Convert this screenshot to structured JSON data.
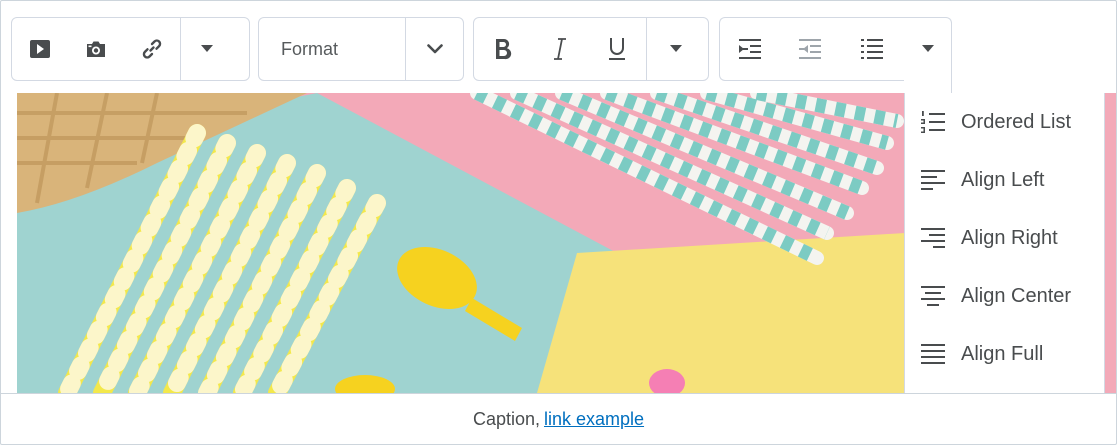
{
  "toolbar": {
    "format_label": "Format",
    "buttons": [
      {
        "name": "insert-video",
        "icon": "video-play-icon"
      },
      {
        "name": "insert-image",
        "icon": "camera-icon"
      },
      {
        "name": "insert-link",
        "icon": "link-icon"
      },
      {
        "name": "more-insert",
        "icon": "caret-down-icon"
      },
      {
        "name": "format-dropdown",
        "icon": "chevron-down-icon"
      },
      {
        "name": "bold",
        "icon": "bold-icon"
      },
      {
        "name": "italic",
        "icon": "italic-icon"
      },
      {
        "name": "underline",
        "icon": "underline-icon"
      },
      {
        "name": "more-formatting",
        "icon": "caret-down-icon"
      },
      {
        "name": "indent",
        "icon": "indent-icon"
      },
      {
        "name": "outdent",
        "icon": "outdent-icon"
      },
      {
        "name": "bullet-list",
        "icon": "bullet-list-icon"
      },
      {
        "name": "more-paragraph",
        "icon": "caret-down-icon"
      }
    ]
  },
  "menu": {
    "items": [
      {
        "label": "Ordered List",
        "icon": "ordered-list-icon"
      },
      {
        "label": "Align Left",
        "icon": "align-left-icon"
      },
      {
        "label": "Align Right",
        "icon": "align-right-icon"
      },
      {
        "label": "Align Center",
        "icon": "align-center-icon"
      },
      {
        "label": "Align Full",
        "icon": "align-full-icon"
      }
    ]
  },
  "caption": {
    "text": "Caption,",
    "link_text": "link example"
  },
  "colors": {
    "icon": "#494c4e",
    "icon_disabled": "#9ea5ab",
    "border": "#d3d9e3",
    "link": "#006fbf",
    "photo_pink": "#f3a9b8",
    "photo_teal": "#9fd3d0",
    "photo_yellow": "#f6e27a"
  }
}
